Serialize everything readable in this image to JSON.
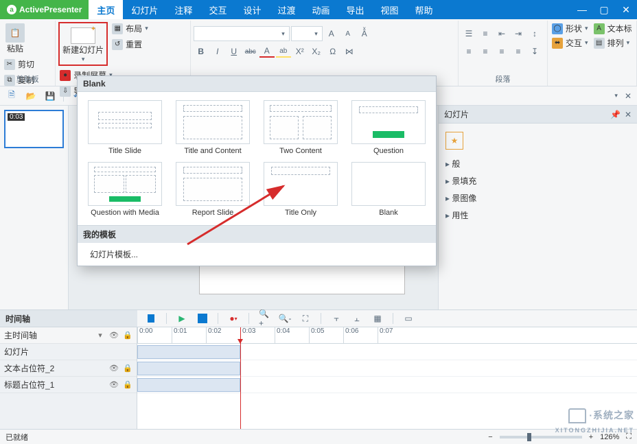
{
  "app": {
    "name": "ActivePresenter"
  },
  "menu": {
    "tabs": [
      "主页",
      "幻灯片",
      "注释",
      "交互",
      "设计",
      "过渡",
      "动画",
      "导出",
      "视图",
      "帮助"
    ],
    "active": 0
  },
  "ribbon": {
    "clipboard": {
      "paste": "粘贴",
      "cut": "剪切",
      "copy": "复制",
      "group_label": "剪贴板"
    },
    "slides": {
      "new_slide": "新建幻灯片",
      "layout": "布局",
      "record_screen": "录制屏幕",
      "reset": "重置",
      "import_slides": "导入幻灯片"
    },
    "font": {
      "font_placeholder": "",
      "size_placeholder": "",
      "grow": "A",
      "shrink": "A",
      "clear": "Aͯ",
      "bold": "B",
      "italic": "I",
      "underline": "U",
      "strike": "abc",
      "fontcolor": "A",
      "highlight": "ab",
      "super": "X²",
      "sub": "X₂",
      "omega": "Ω",
      "link": "⋈"
    },
    "paragraph": {
      "group_label": "段落"
    },
    "insert": {
      "shape": "形状",
      "textbox": "文本标",
      "interact": "交互",
      "arrange": "排列"
    }
  },
  "qat": {},
  "slide_panel": {
    "duration": "0:03"
  },
  "gallery": {
    "header": "Blank",
    "items": [
      "Title Slide",
      "Title and Content",
      "Two Content",
      "Question",
      "Question with Media",
      "Report Slide",
      "Title Only",
      "Blank"
    ],
    "footer_header": "我的模板",
    "footer_link": "幻灯片模板..."
  },
  "right_panel": {
    "title": "幻灯片",
    "items": [
      "般",
      "景填充",
      "景图像",
      "用性"
    ]
  },
  "timeline": {
    "title": "时间轴",
    "main_track": "主时间轴",
    "tracks": [
      "幻灯片",
      "文本占位符_2",
      "标题占位符_1"
    ],
    "ticks": [
      "0:00",
      "0:01",
      "0:02",
      "0:03",
      "0:04",
      "0:05",
      "0:06",
      "0:07"
    ]
  },
  "status": {
    "text": "已就绪",
    "zoom": "126%"
  },
  "watermark": {
    "text": "·系统之家",
    "url": "XITONGZHIJIA.NET"
  }
}
